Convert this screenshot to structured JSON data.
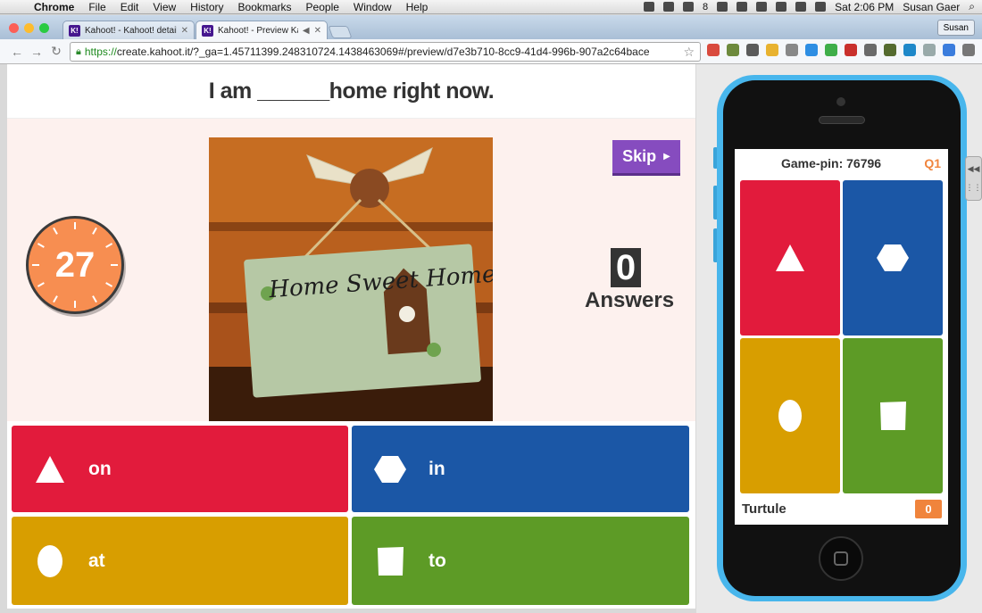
{
  "menubar": {
    "app": "Chrome",
    "items": [
      "File",
      "Edit",
      "View",
      "History",
      "Bookmarks",
      "People",
      "Window",
      "Help"
    ],
    "status_num": "8",
    "clock": "Sat 2:06 PM",
    "user": "Susan Gaer"
  },
  "tabs": [
    {
      "icon": "K!",
      "title": "Kahoot! - Kahoot! details"
    },
    {
      "icon": "K!",
      "title": "Kahoot! - Preview Kahoot"
    }
  ],
  "profile_button": "Susan",
  "address": {
    "scheme": "https://",
    "rest": "create.kahoot.it/?_ga=1.45711399.248310724.1438463069#/preview/d7e3b710-8cc9-41d4-996b-907a2c64bace"
  },
  "game": {
    "question": "I am ______home right now.",
    "timer": "27",
    "skip_label": "Skip",
    "answer_count": "0",
    "answers_label": "Answers",
    "image_text": "Home Sweet Home",
    "answers": [
      {
        "text": "on",
        "shape": "triangle",
        "color": "#e21b3c"
      },
      {
        "text": "in",
        "shape": "hexagon",
        "color": "#1368ce"
      },
      {
        "text": "at",
        "shape": "circle",
        "color": "#d89e00"
      },
      {
        "text": "to",
        "shape": "square",
        "color": "#26890c"
      }
    ]
  },
  "phone": {
    "pin_label": "Game-pin: 76796",
    "question_num": "Q1",
    "player": "Turtule",
    "score": "0"
  },
  "colors": {
    "red": "#e21b3c",
    "blue": "#1b57a6",
    "yellow": "#d89e00",
    "green": "#5d9b26",
    "purple": "#864cbf",
    "orange": "#f78e51",
    "phone_blue": "#48b6ec"
  }
}
